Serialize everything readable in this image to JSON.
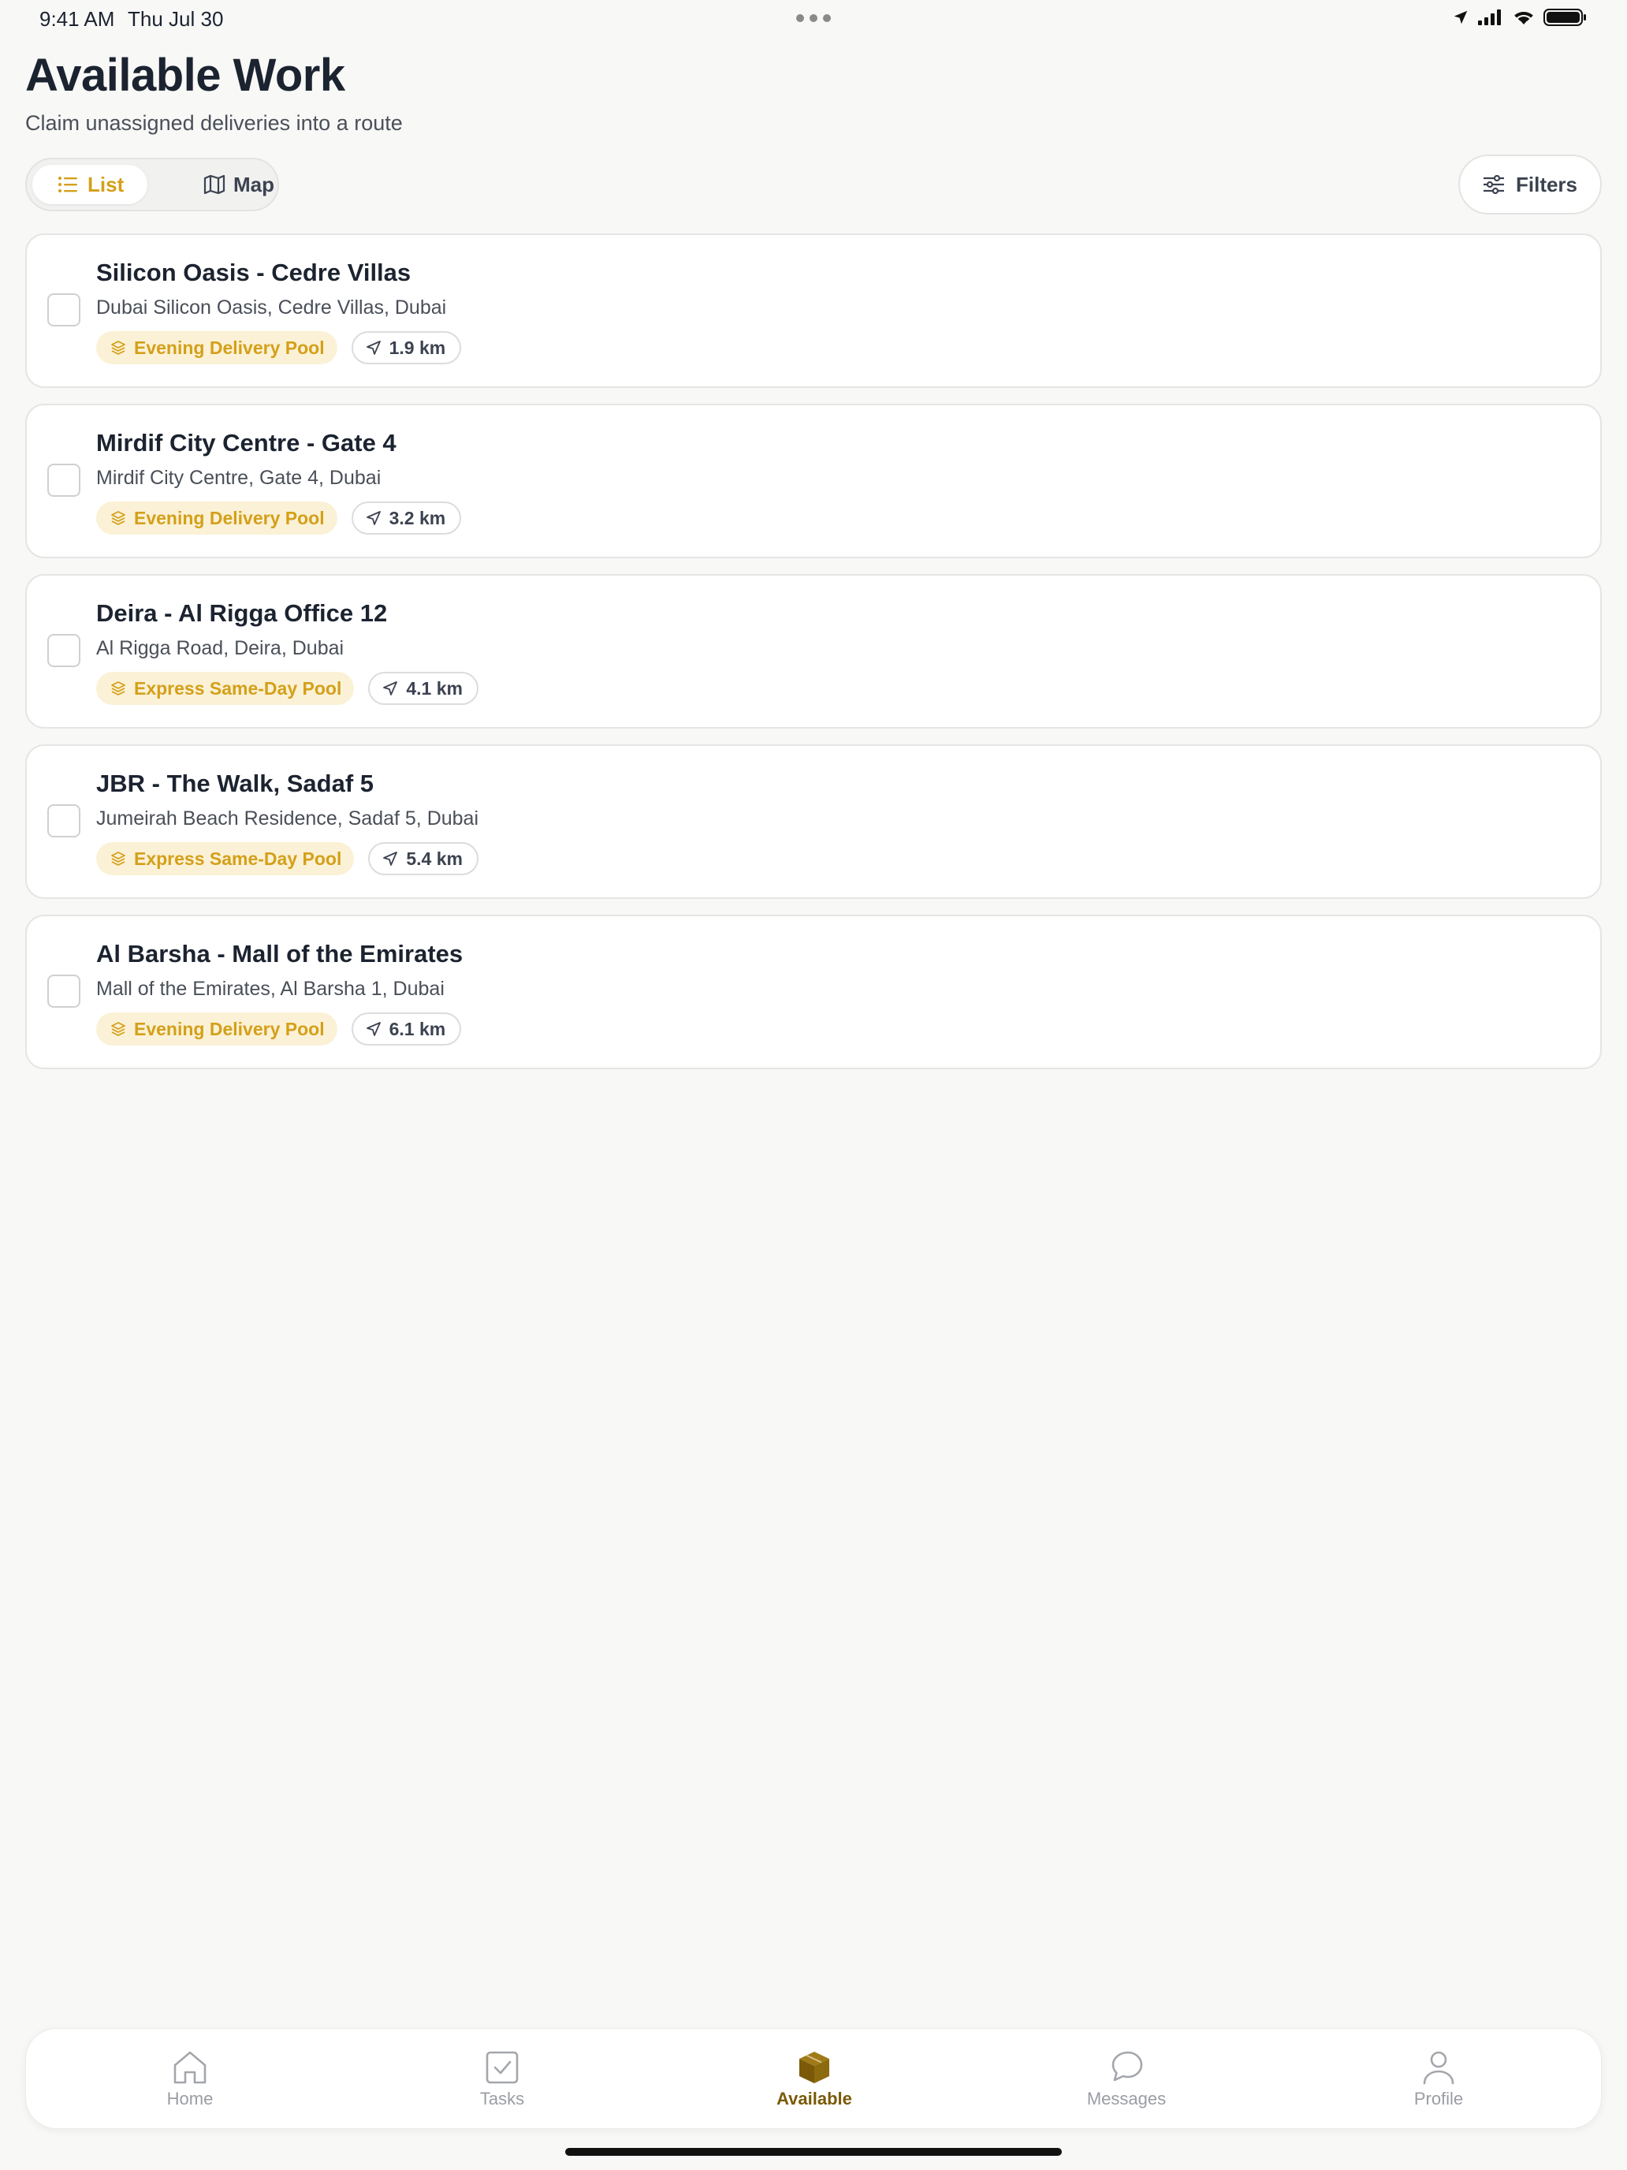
{
  "status_bar": {
    "time": "9:41 AM",
    "date": "Thu Jul 30"
  },
  "header": {
    "title": "Available Work",
    "subtitle": "Claim unassigned deliveries into a route"
  },
  "view_toggle": {
    "list_label": "List",
    "map_label": "Map",
    "selected": "List"
  },
  "filters": {
    "label": "Filters"
  },
  "colors": {
    "accent": "#d4a019",
    "accent_bg": "#fbf1d6",
    "active_tab": "#7a5a08"
  },
  "deliveries": [
    {
      "title": "Silicon Oasis - Cedre Villas",
      "address": "Dubai Silicon Oasis, Cedre Villas, Dubai",
      "pool": "Evening Delivery Pool",
      "distance": "1.9 km"
    },
    {
      "title": "Mirdif City Centre - Gate 4",
      "address": "Mirdif City Centre, Gate 4, Dubai",
      "pool": "Evening Delivery Pool",
      "distance": "3.2 km"
    },
    {
      "title": "Deira - Al Rigga Office 12",
      "address": "Al Rigga Road, Deira, Dubai",
      "pool": "Express Same-Day Pool",
      "distance": "4.1 km"
    },
    {
      "title": "JBR - The Walk, Sadaf 5",
      "address": "Jumeirah Beach Residence, Sadaf 5, Dubai",
      "pool": "Express Same-Day Pool",
      "distance": "5.4 km"
    },
    {
      "title": "Al Barsha - Mall of the Emirates",
      "address": "Mall of the Emirates, Al Barsha 1, Dubai",
      "pool": "Evening Delivery Pool",
      "distance": "6.1 km"
    }
  ],
  "tab_bar": {
    "items": [
      {
        "label": "Home",
        "icon": "home-icon"
      },
      {
        "label": "Tasks",
        "icon": "check-square-icon"
      },
      {
        "label": "Available",
        "icon": "package-icon"
      },
      {
        "label": "Messages",
        "icon": "message-icon"
      },
      {
        "label": "Profile",
        "icon": "user-icon"
      }
    ],
    "active": "Available"
  }
}
